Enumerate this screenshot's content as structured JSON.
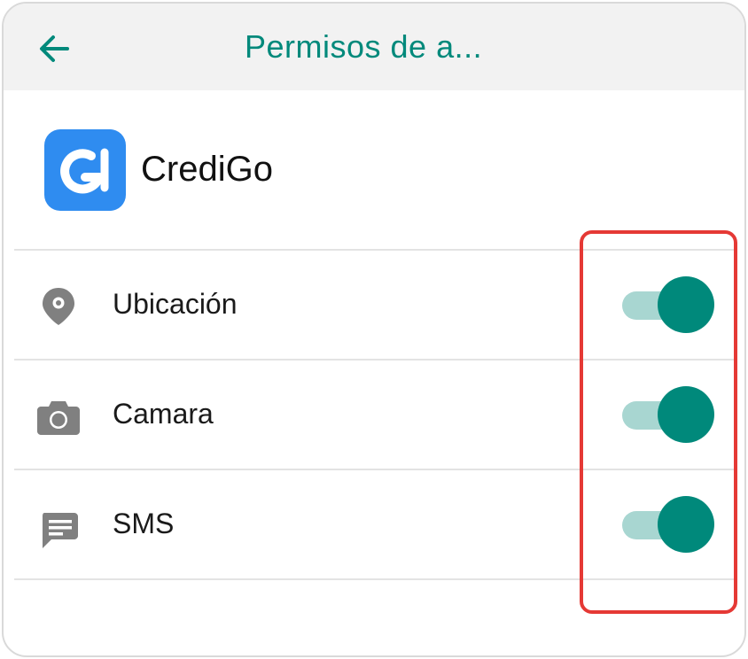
{
  "appbar": {
    "title": "Permisos de a...",
    "back_icon": "arrow-back-icon"
  },
  "app": {
    "name": "CrediGo",
    "icon": "credigo-logo-icon"
  },
  "permissions": [
    {
      "label": "Ubicación",
      "icon": "location-pin-icon",
      "enabled": true
    },
    {
      "label": "Camara",
      "icon": "camera-icon",
      "enabled": true
    },
    {
      "label": "SMS",
      "icon": "message-icon",
      "enabled": true
    }
  ],
  "colors": {
    "accent": "#00897b",
    "track_on": "#a8d6d1",
    "appbar_bg": "#f2f2f2",
    "app_icon_bg": "#2f8cf0",
    "highlight": "#e53935",
    "icon_gray": "#808080"
  }
}
